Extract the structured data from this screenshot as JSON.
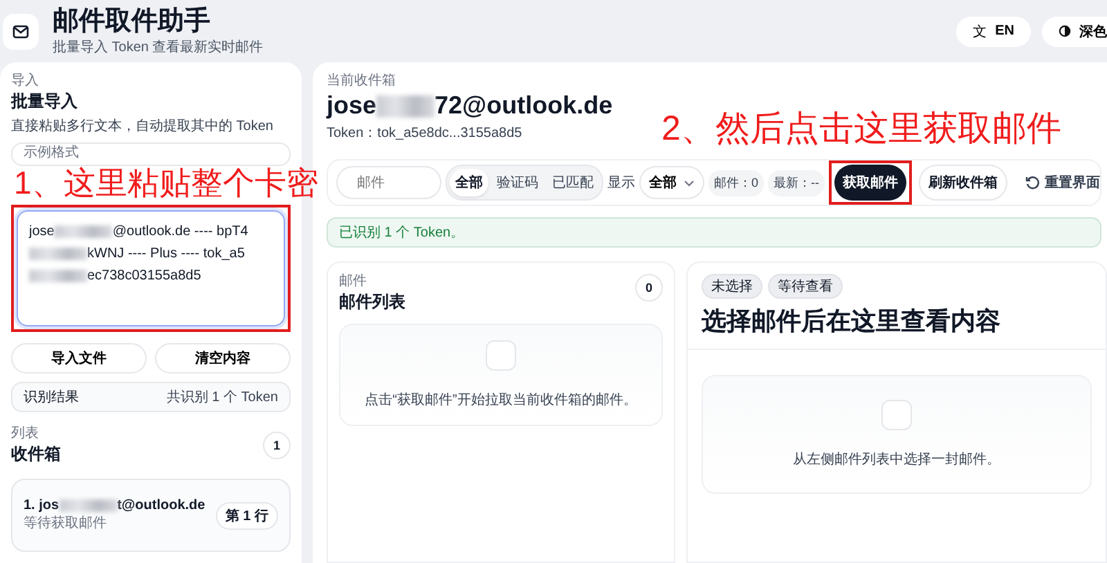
{
  "header": {
    "title": "邮件取件助手",
    "subtitle": "批量导入 Token 查看最新实时邮件",
    "buttons": [
      {
        "kind": "language",
        "icon": "文",
        "label": "EN"
      },
      {
        "kind": "theme",
        "label": "深色"
      }
    ]
  },
  "import": {
    "eyebrow": "导入",
    "title": "批量导入",
    "description": "直接粘贴多行文本，自动提取其中的 Token",
    "sample_label": "示例格式",
    "paste": {
      "highlighted": true,
      "parts": [
        "jose",
        "@outlook.de ---- bpT4",
        "kWNJ ---- Plus ---- tok_a5",
        "ec738c03155a8d5"
      ]
    },
    "buttons": [
      "导入文件",
      "清空内容"
    ],
    "result": {
      "label": "识别结果",
      "value": "共识别 1 个 Token"
    }
  },
  "inbox": {
    "eyebrow": "列表",
    "title": "收件箱",
    "count": "1",
    "items": [
      {
        "parts": [
          "1. jos",
          "t@outlook.de"
        ],
        "status": "等待获取邮件",
        "badge": "第 1 行"
      }
    ]
  },
  "current": {
    "eyebrow": "当前收件箱",
    "email_parts": [
      "jose",
      "72@outlook.de"
    ],
    "token": "Token：tok_a5e8dc...3155a8d5"
  },
  "toolbar": {
    "search_placeholder": "邮件",
    "filters": [
      {
        "label": "全部",
        "selected": true
      },
      {
        "label": "验证码",
        "selected": false
      },
      {
        "label": "已匹配",
        "selected": false
      }
    ],
    "show_label": "显示",
    "dropdown": "全部",
    "stats": [
      "邮件：0",
      "最新：--"
    ],
    "actions": [
      {
        "kind": "primary",
        "label": "获取邮件",
        "highlighted": true
      },
      {
        "kind": "outline",
        "label": "刷新收件箱",
        "highlighted": false
      },
      {
        "kind": "reset",
        "label": "重置界面",
        "highlighted": false
      }
    ]
  },
  "notice": "已识别 1 个 Token。",
  "mail_list": {
    "eyebrow": "邮件",
    "title": "邮件列表",
    "count": "0",
    "empty": "点击“获取邮件”开始拉取当前收件箱的邮件。"
  },
  "viewer": {
    "tags": [
      "未选择",
      "等待查看"
    ],
    "title": "选择邮件后在这里查看内容",
    "empty": "从左侧邮件列表中选择一封邮件。"
  },
  "annotations": [
    {
      "text": "1、这里粘贴整个卡密"
    },
    {
      "text": "2、然后点击这里获取邮件"
    }
  ]
}
